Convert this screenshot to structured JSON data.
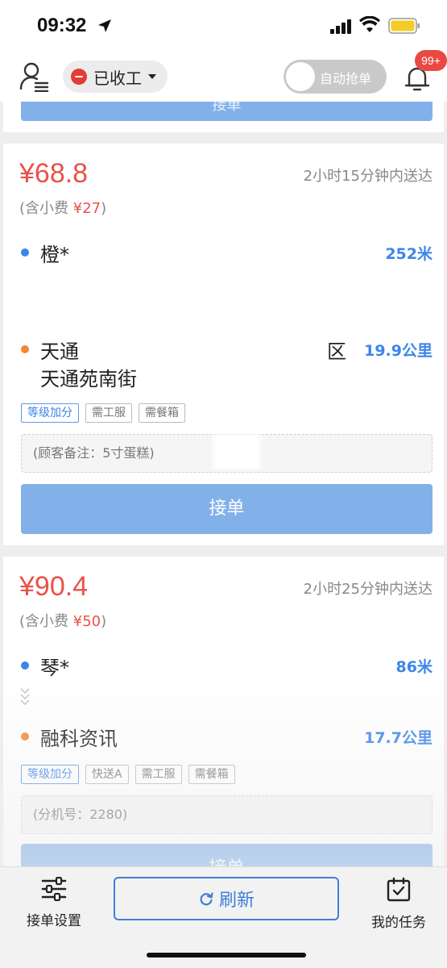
{
  "status_bar": {
    "time": "09:32"
  },
  "header": {
    "work_status": "已收工",
    "auto_grab": "自动抢单",
    "notification_badge": "99+"
  },
  "previous_card": {
    "accept_label": "接单"
  },
  "orders": [
    {
      "price": "¥68.8",
      "tip_prefix": "(含小费",
      "tip_amount": "¥27",
      "tip_suffix": ")",
      "eta": "2小时15分钟内送达",
      "pickup_name": "橙*",
      "pickup_distance": "252米",
      "dropoff_name": "天通",
      "dropoff_name_tail": "区",
      "dropoff_address": "天通苑南街",
      "dropoff_distance": "19.9公里",
      "tags": [
        "等级加分",
        "需工服",
        "需餐箱"
      ],
      "note": "(顾客备注：5寸蛋糕)",
      "accept_label": "接单"
    },
    {
      "price": "¥90.4",
      "tip_prefix": "(含小费",
      "tip_amount": "¥50",
      "tip_suffix": ")",
      "eta": "2小时25分钟内送达",
      "pickup_name": "琴*",
      "pickup_distance": "86米",
      "dropoff_name": "融科资讯",
      "dropoff_distance": "17.7公里",
      "tags": [
        "等级加分",
        "快送A",
        "需工服",
        "需餐箱"
      ],
      "note": "(分机号：2280)",
      "accept_label": "接单"
    }
  ],
  "bottom_bar": {
    "settings_label": "接单设置",
    "refresh_label": "刷新",
    "tasks_label": "我的任务"
  }
}
